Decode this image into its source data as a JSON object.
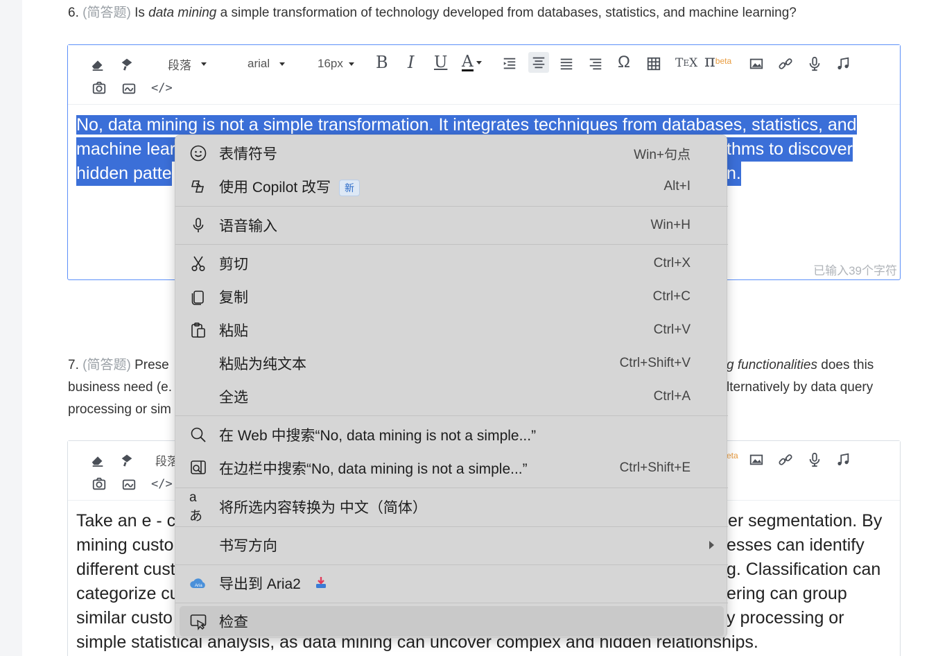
{
  "q6": {
    "num": "6.",
    "type": "(简答题)",
    "pre": "Is",
    "em": "data mining",
    "post": "a simple transformation of technology developed from databases, statistics, and machine learning?"
  },
  "toolbar": {
    "paragraph": "段落",
    "font": "arial",
    "size": "16px",
    "beta": "beta"
  },
  "editor1": {
    "line1": "No, data mining is not a simple transformation. It integrates techniques from databases, statistics, and",
    "line2_left": "machine lear",
    "line2_right": "thms to discover",
    "line3_left": "hidden patte",
    "line3_right": "n.",
    "counter": "已输入39个字符"
  },
  "q7": {
    "num": "7.",
    "type": "(简答题)",
    "l1_left": "Prese",
    "l1_right_em": "g functionalities",
    "l1_right": "does this",
    "l2_left": "business need (e.",
    "l2_right": "lternatively by data query",
    "l3_left": "processing or sim"
  },
  "editor2": {
    "paragraph": "段落",
    "beta": "eta",
    "lines_left": [
      "Take an e - co",
      "mining custo",
      "different cust",
      "categorize cu",
      "similar custo"
    ],
    "lines_right": [
      "er segmentation. By",
      "esses can identify",
      "g. Classification can",
      "ering can group",
      "y processing or"
    ],
    "last_line": "simple statistical analysis, as data mining can uncover complex and hidden relationships."
  },
  "context_menu": {
    "emoji": {
      "label": "表情符号",
      "shortcut": "Win+句点"
    },
    "copilot": {
      "label": "使用 Copilot 改写",
      "badge": "新",
      "shortcut": "Alt+I"
    },
    "voice": {
      "label": "语音输入",
      "shortcut": "Win+H"
    },
    "cut": {
      "label": "剪切",
      "shortcut": "Ctrl+X"
    },
    "copy": {
      "label": "复制",
      "shortcut": "Ctrl+C"
    },
    "paste": {
      "label": "粘贴",
      "shortcut": "Ctrl+V"
    },
    "paste_plain": {
      "label": "粘贴为纯文本",
      "shortcut": "Ctrl+Shift+V"
    },
    "select_all": {
      "label": "全选",
      "shortcut": "Ctrl+A"
    },
    "search_web": {
      "label": "在 Web 中搜索“No, data mining is not a simple...”"
    },
    "search_sidebar": {
      "label": "在边栏中搜索“No, data mining is not a simple...”",
      "shortcut": "Ctrl+Shift+E"
    },
    "translate": {
      "label": "将所选内容转换为 中文（简体）"
    },
    "writing_dir": {
      "label": "书写方向"
    },
    "aria2": {
      "label": "导出到 Aria2"
    },
    "inspect": {
      "label": "检查"
    }
  }
}
